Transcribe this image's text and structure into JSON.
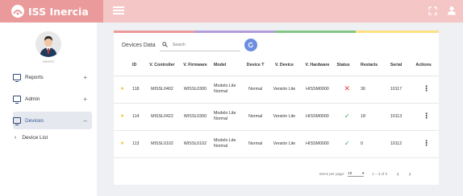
{
  "header": {
    "title": "ISS Inercia",
    "menu_icon": "hamburger-icon",
    "fullscreen_icon": "expand-icon",
    "account_icon": "user-icon"
  },
  "sidebar": {
    "username": "INERSI",
    "items": [
      {
        "label": "Reports",
        "sign": "+"
      },
      {
        "label": "Admin",
        "sign": "+"
      },
      {
        "label": "Devices",
        "sign": "–"
      }
    ],
    "subitems": [
      {
        "label": "Device List"
      }
    ]
  },
  "main": {
    "title": "Devices Data",
    "search_placeholder": "Search",
    "columns": [
      "ID",
      "V. Controller",
      "V. Firmware",
      "Model",
      "Device T",
      "V. Device",
      "V. Hardware",
      "Status",
      "Restarts",
      "Serial",
      "Actions"
    ],
    "rows": [
      {
        "id": "118",
        "controller": "MISSL0402",
        "firmware": "WISSL0300",
        "model": "Modelo Lite Normal",
        "type": "Normal",
        "device": "Versión Lite",
        "hardware": "HISSM0000",
        "status": "error",
        "restarts": "36",
        "serial": "10117"
      },
      {
        "id": "114",
        "controller": "MISSL0422",
        "firmware": "WISSL0300",
        "model": "Modelo Lite Normal",
        "type": "Normal",
        "device": "Versión Lite",
        "hardware": "HISSM0000",
        "status": "ok",
        "restarts": "18",
        "serial": "10113"
      },
      {
        "id": "113",
        "controller": "MISSL0102",
        "firmware": "WISSL0102",
        "model": "Modelo Lite Normal",
        "type": "Normal",
        "device": "Versión Lite",
        "hardware": "HISSM0000",
        "status": "ok",
        "restarts": "0",
        "serial": "10112"
      }
    ],
    "pagination": {
      "items_label": "Items per page:",
      "page_size": "10",
      "range": "1 – 3 of 3"
    }
  },
  "colors": {
    "topbar": "#f5c6c6",
    "brand": "#ea9a9a",
    "accent": "#6c8ee0",
    "stripes": [
      "#ef9a9a",
      "#b39ddb",
      "#81c784",
      "#ffe082"
    ]
  }
}
